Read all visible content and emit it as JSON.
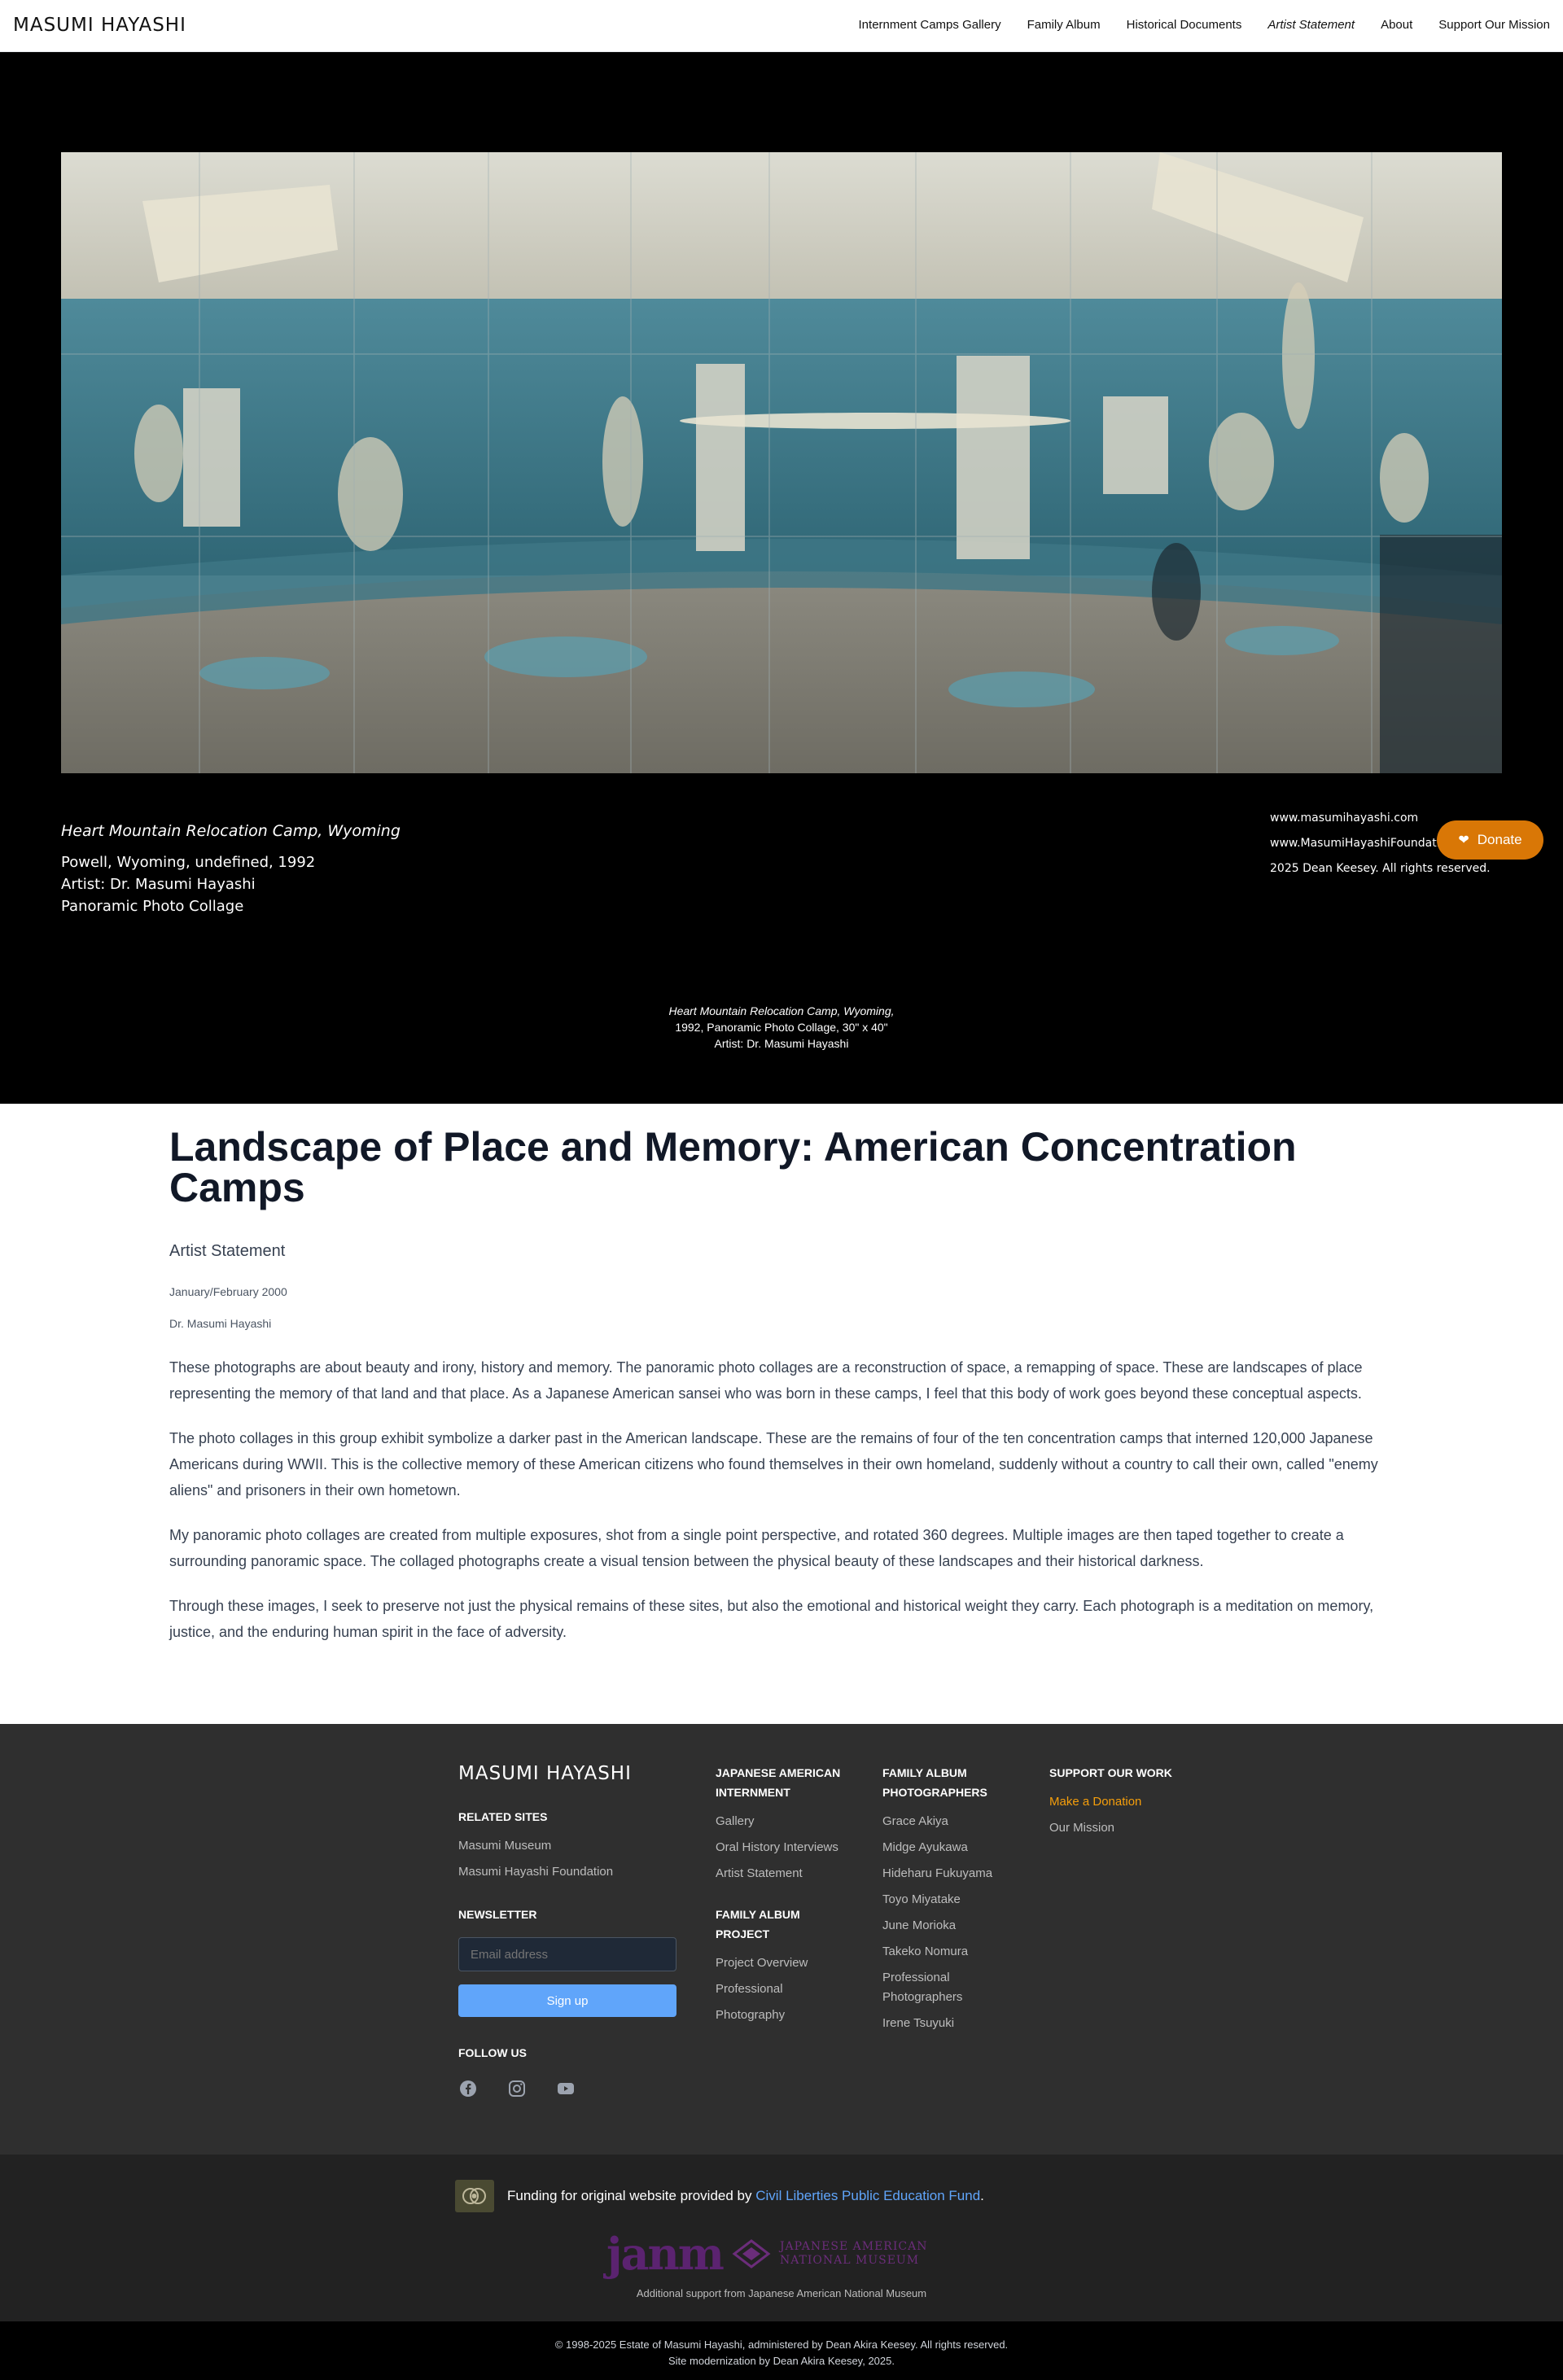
{
  "header": {
    "logo": "MASUMI HAYASHI",
    "nav": [
      {
        "label": "Internment Camps Gallery"
      },
      {
        "label": "Family Album"
      },
      {
        "label": "Historical Documents"
      },
      {
        "label": "Artist Statement"
      },
      {
        "label": "About"
      },
      {
        "label": "Support Our Mission"
      }
    ]
  },
  "hero": {
    "place": "Heart Mountain Relocation Camp, Wyoming",
    "location_date": "Powell, Wyoming, undefined, 1992",
    "artist": "Artist: Dr. Masumi Hayashi",
    "medium": "Panoramic Photo Collage",
    "site1": "www.masumihayashi.com",
    "site2": "www.MasumiHayashiFoundation.org",
    "rights": "2025 Dean Keesey. All rights reserved.",
    "donate_label": "Donate",
    "caption": {
      "title": "Heart Mountain Relocation Camp, Wyoming,",
      "details": "1992, Panoramic Photo Collage, 30\" x 40\"",
      "artist": "Artist: Dr. Masumi Hayashi"
    }
  },
  "article": {
    "title": "Landscape of Place and Memory: American Concentration Camps",
    "subtitle": "Artist Statement",
    "date": "January/February 2000",
    "author": "Dr. Masumi Hayashi",
    "paragraphs": [
      "These photographs are about beauty and irony, history and memory. The panoramic photo collages are a reconstruction of space, a remapping of space. These are landscapes of place representing the memory of that land and that place. As a Japanese American sansei who was born in these camps, I feel that this body of work goes beyond these conceptual aspects.",
      "The photo collages in this group exhibit symbolize a darker past in the American landscape. These are the remains of four of the ten concentration camps that interned 120,000 Japanese Americans during WWII. This is the collective memory of these American citizens who found themselves in their own homeland, suddenly without a country to call their own, called \"enemy aliens\" and prisoners in their own hometown.",
      "My panoramic photo collages are created from multiple exposures, shot from a single point perspective, and rotated 360 degrees. Multiple images are then taped together to create a surrounding panoramic space. The collaged photographs create a visual tension between the physical beauty of these landscapes and their historical darkness.",
      "Through these images, I seek to preserve not just the physical remains of these sites, but also the emotional and historical weight they carry. Each photograph is a meditation on memory, justice, and the enduring human spirit in the face of adversity."
    ]
  },
  "footer": {
    "brand": "MASUMI HAYASHI",
    "related_heading": "RELATED SITES",
    "related": [
      "Masumi Museum",
      "Masumi Hayashi Foundation"
    ],
    "newsletter_heading": "NEWSLETTER",
    "email_placeholder": "Email address",
    "signup_label": "Sign up",
    "follow_heading": "FOLLOW US",
    "social_icons": [
      "facebook-icon",
      "instagram-icon",
      "youtube-icon"
    ],
    "internment_heading": "JAPANESE AMERICAN INTERNMENT",
    "internment_links": [
      "Gallery",
      "Oral History Interviews",
      "Artist Statement"
    ],
    "album_project_heading": "FAMILY ALBUM PROJECT",
    "album_project_links": [
      "Project Overview",
      "Professional Photography"
    ],
    "photographers_heading": "FAMILY ALBUM PHOTOGRAPHERS",
    "photographers": [
      "Grace Akiya",
      "Midge Ayukawa",
      "Hideharu Fukuyama",
      "Toyo Miyatake",
      "June Morioka",
      "Takeko Nomura",
      "Professional Photographers",
      "Irene Tsuyuki"
    ],
    "support_heading": "SUPPORT OUR WORK",
    "support_links": [
      "Make a Donation",
      "Our Mission"
    ],
    "accent": "#f59e0b"
  },
  "credits": {
    "funding_prefix": "Funding for original website provided by ",
    "funding_link": "Civil Liberties Public Education Fund",
    "funding_suffix": ".",
    "janm_logo": "janm",
    "janm_line1": "JAPANESE AMERICAN",
    "janm_line2": "NATIONAL MUSEUM",
    "janm_support": "Additional support from Japanese American National Museum"
  },
  "copyright": {
    "line1": "© 1998-2025 Estate of Masumi Hayashi, administered by Dean Akira Keesey. All rights reserved.",
    "line2": "Site modernization by Dean Akira Keesey, 2025."
  }
}
